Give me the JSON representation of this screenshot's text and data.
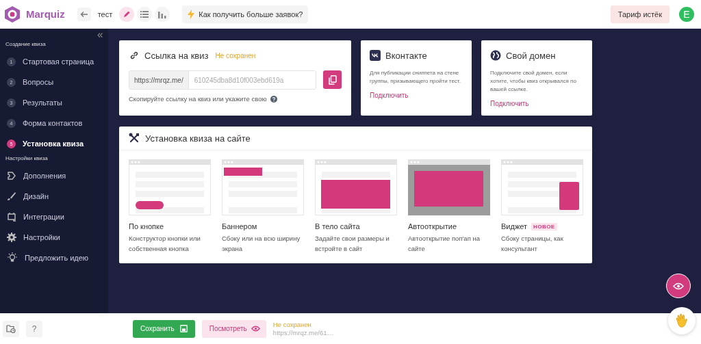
{
  "brand": "Marquiz",
  "topbar": {
    "quiz_name": "тест",
    "modes": [
      {
        "kind": "edit",
        "selected": true
      },
      {
        "kind": "list",
        "selected": false
      },
      {
        "kind": "stats",
        "selected": false
      }
    ],
    "tip": "Как получить больше заявок?",
    "plan": "Тариф истёк",
    "avatar": "E"
  },
  "sidebar": {
    "sections": [
      {
        "title": "Создание квиза",
        "items": [
          {
            "kind": "step",
            "number": "1",
            "label": "Стартовая страница",
            "selected": false
          },
          {
            "kind": "step",
            "number": "2",
            "label": "Вопросы",
            "selected": false
          },
          {
            "kind": "step",
            "number": "3",
            "label": "Результаты",
            "selected": false
          },
          {
            "kind": "step",
            "number": "4",
            "label": "Форма контактов",
            "selected": false
          },
          {
            "kind": "step",
            "number": "5",
            "label": "Установка квиза",
            "selected": true
          }
        ]
      },
      {
        "title": "Настройки квиза",
        "items": [
          {
            "kind": "addons",
            "label": "Дополнения",
            "selected": false
          },
          {
            "kind": "design",
            "label": "Дизайн",
            "selected": false
          },
          {
            "kind": "integrations",
            "label": "Интеграции",
            "selected": false
          },
          {
            "kind": "settings",
            "label": "Настройки",
            "selected": false
          },
          {
            "kind": "idea",
            "label": "Предложить идею",
            "selected": false
          }
        ]
      }
    ]
  },
  "link_card": {
    "title": "Ссылка на квиз",
    "status": "Не сохранен",
    "prefix": "https://mrqz.me/",
    "placeholder": "610245dba8d10f003ebd619a",
    "hint": "Скопируйте ссылку на квиз или укажите свою"
  },
  "side_cards": [
    {
      "kind": "vk",
      "title": "Вконтакте",
      "text": "Для публикации сниппета на стене группы, призывающего пройти тест.",
      "link": "Подключить"
    },
    {
      "kind": "domain",
      "title": "Свой домен",
      "text": "Подключите свой домен, если хотите, чтобы квиз открывался по вашей ссылке.",
      "link": "Подключить"
    }
  ],
  "install": {
    "title": "Установка квиза на сайте",
    "options": [
      {
        "kind": "button",
        "title": "По кнопке",
        "text": "Конструктор кнопки или собственная кнопка"
      },
      {
        "kind": "banner",
        "title": "Баннером",
        "text": "Сбоку или на всю ширину экрана"
      },
      {
        "kind": "inline",
        "title": "В тело сайта",
        "text": "Задайте свои размеры и встройте в сайт"
      },
      {
        "kind": "popup",
        "title": "Автооткрытие",
        "text": "Автооткрытие поп'ап на сайте"
      },
      {
        "kind": "widget",
        "title": "Виджет",
        "badge": "НОВОЕ",
        "text": "Сбоку страницы, как консультант"
      }
    ]
  },
  "bottom": {
    "save": "Сохранить",
    "preview": "Посмотреть",
    "status": "Не сохранен",
    "url": "https://mrqz.me/61…",
    "help": "?"
  }
}
